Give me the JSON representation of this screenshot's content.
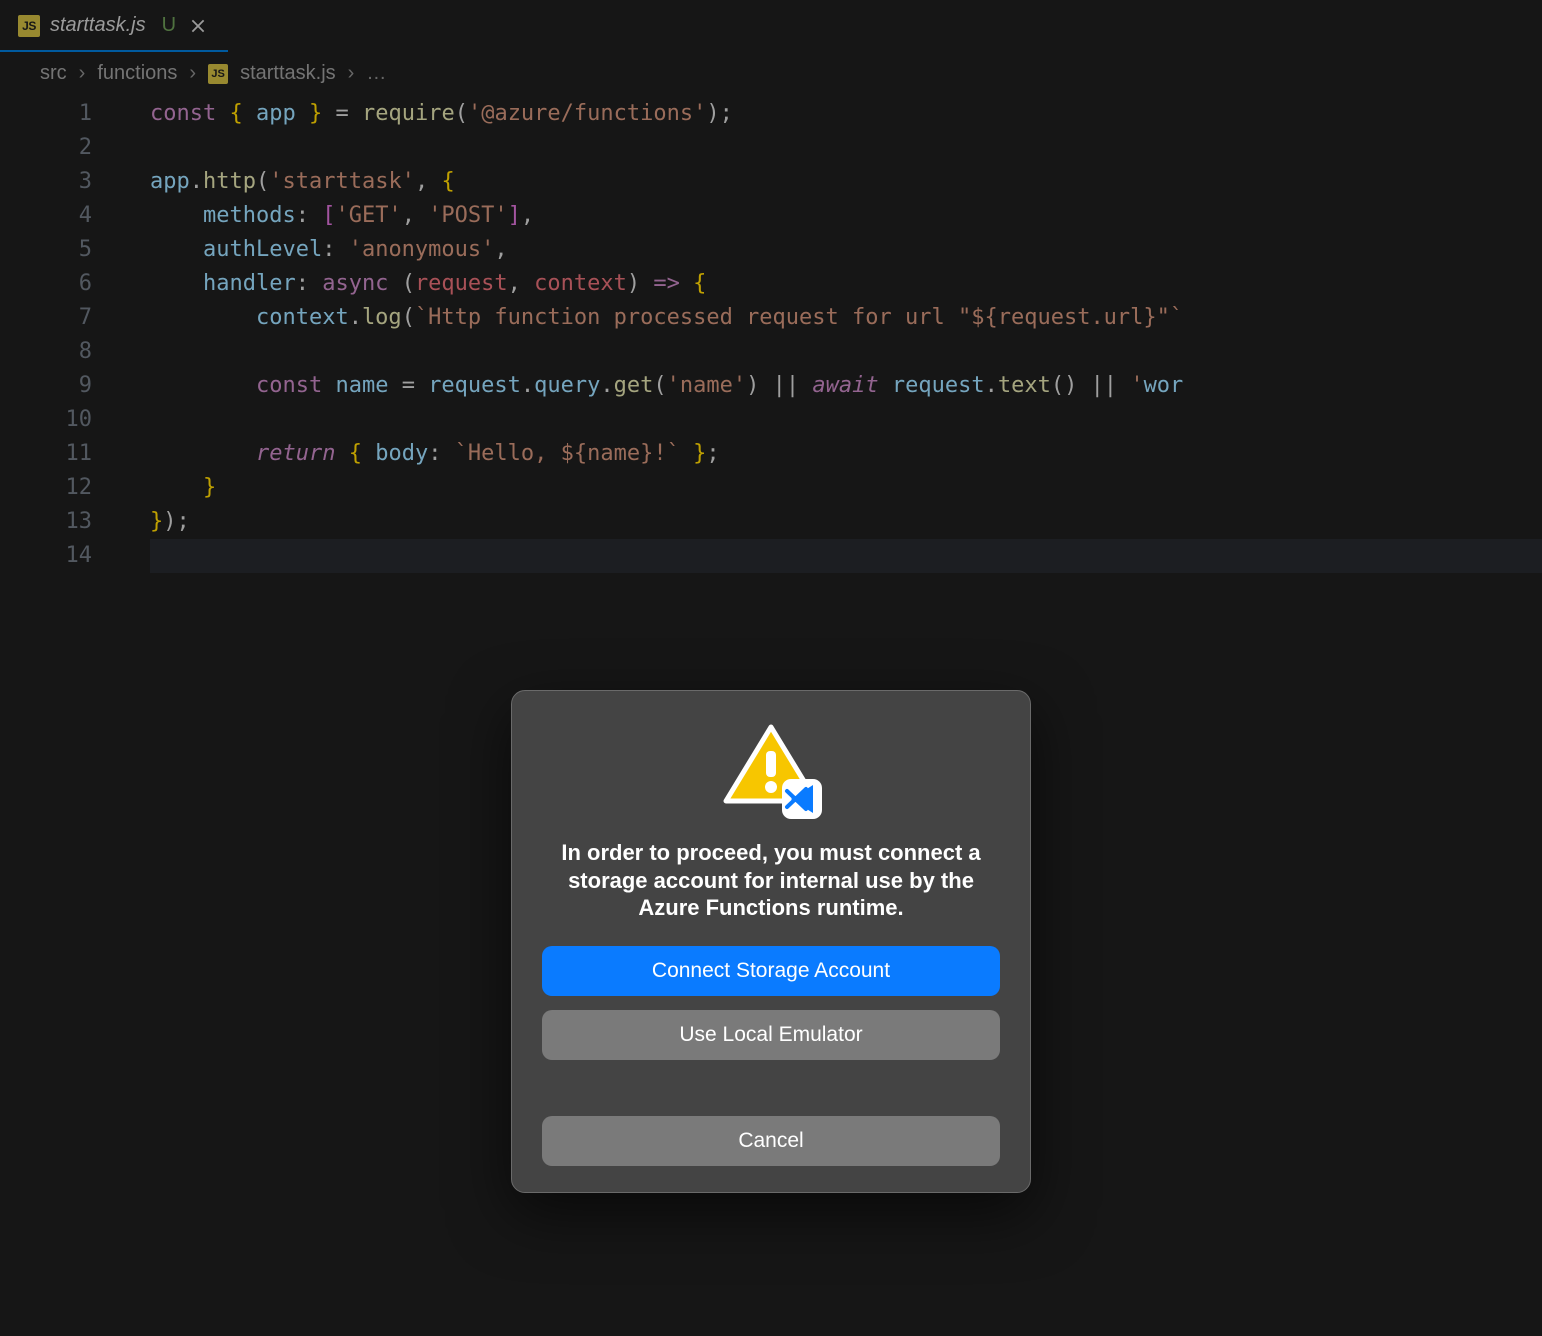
{
  "tab": {
    "filename": "starttask.js",
    "modified_marker": "U",
    "icon_text": "JS"
  },
  "breadcrumb": {
    "parts": [
      "src",
      "functions",
      "starttask.js"
    ],
    "icon_text": "JS",
    "trailing": "…"
  },
  "editor": {
    "line_numbers": [
      1,
      2,
      3,
      4,
      5,
      6,
      7,
      8,
      9,
      10,
      11,
      12,
      13,
      14
    ],
    "code_lines": [
      "const { app } = require('@azure/functions');",
      "",
      "app.http('starttask', {",
      "    methods: ['GET', 'POST'],",
      "    authLevel: 'anonymous',",
      "    handler: async (request, context) => {",
      "        context.log(`Http function processed request for url \"${request.url}\"`",
      "",
      "        const name = request.query.get('name') || await request.text() || 'wor",
      "",
      "        return { body: `Hello, ${name}!` };",
      "    }",
      "});",
      ""
    ]
  },
  "modal": {
    "message": "In order to proceed, you must connect a storage account for internal use by the Azure Functions runtime.",
    "buttons": {
      "primary": "Connect Storage Account",
      "secondary": "Use Local Emulator",
      "cancel": "Cancel"
    },
    "icons": {
      "warning": "warning-icon",
      "vscode": "vscode-icon"
    }
  },
  "colors": {
    "accent": "#0a7bff",
    "background": "#1e1e1e",
    "modal_bg": "#444444"
  }
}
